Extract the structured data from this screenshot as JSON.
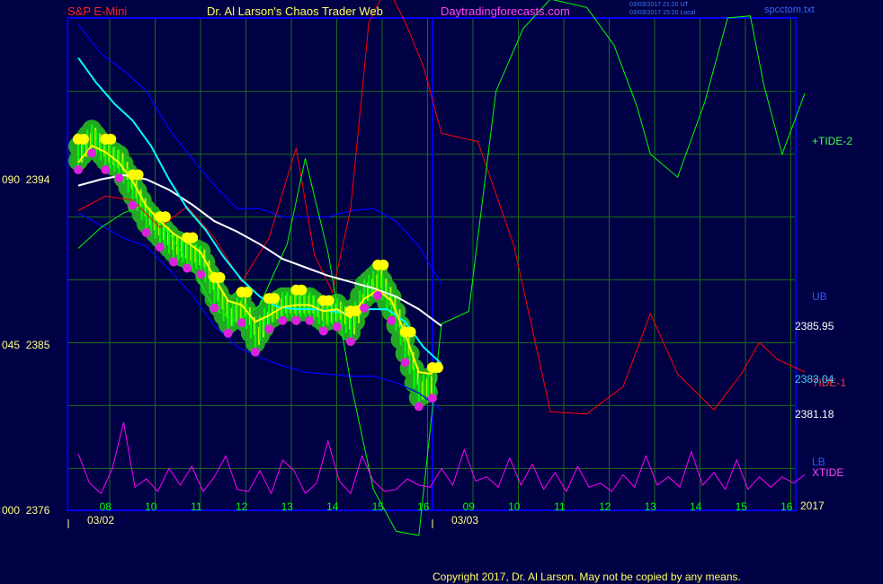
{
  "header": {
    "symbol": "S&P E-Mini",
    "title": "Dr. Al Larson's Chaos Trader Web",
    "website": "Daytradingforecasts.com",
    "stamp_line1": "03/03/2017 21:20 UT",
    "stamp_line2": "03/03/2017 15:20 Local",
    "file_name": "spcctom.txt"
  },
  "footer": {
    "copyright": "Copyright 2017, Dr. Al Larson. May not be copied by any means."
  },
  "colors": {
    "background": "#000044",
    "frame": "#0000ff",
    "grid": "#1c6b1c",
    "price_bar": "#00ff00",
    "ema_fast": "#ffff00",
    "ema_mid": "#00ffff",
    "ema_slow": "#ffffff",
    "band": "#0000ff",
    "tide_1": "#ff0000",
    "tide_2": "#00ff00",
    "xtide": "#ff00ff"
  },
  "chart_data": {
    "type": "line",
    "title": "S&P E-Mini",
    "xlabel": "",
    "ylabel": "",
    "grid": true,
    "x_tick_labels": [
      "08",
      "10",
      "11",
      "12",
      "13",
      "14",
      "15",
      "16",
      "09",
      "10",
      "11",
      "12",
      "13",
      "14",
      "15",
      "16"
    ],
    "date_labels": [
      "03/02",
      "03/03"
    ],
    "y_tick_labels": [
      "090  2394",
      "045  2385",
      "000  2376"
    ],
    "ylim": [
      2376,
      2399.5
    ],
    "right_labels": {
      "tide2": "+TIDE-2",
      "ub": "UB",
      "price_hi": "2385.95",
      "price_mid": "2383.04",
      "tide1": "TIDE-1",
      "price_lo": "2381.18",
      "lb": "LB",
      "xtide": "XTIDE",
      "year": "2017"
    },
    "series": [
      {
        "key": "price",
        "x": [
          0,
          0.3,
          0.6,
          0.9,
          1.2,
          1.5,
          1.8,
          2.1,
          2.4,
          2.7,
          3.0,
          3.3,
          3.6,
          3.9,
          4.2,
          4.5,
          4.8,
          5.1,
          5.4,
          5.7,
          6.0,
          6.3,
          6.6,
          6.9,
          7.2,
          7.5,
          7.8
        ],
        "values": [
          2393.2,
          2394.0,
          2393.2,
          2392.8,
          2391.5,
          2390.2,
          2389.5,
          2388.8,
          2388.5,
          2388.2,
          2386.6,
          2385.4,
          2385.9,
          2384.5,
          2385.6,
          2386.0,
          2386.0,
          2386.0,
          2385.5,
          2385.7,
          2385.0,
          2386.6,
          2387.2,
          2386.0,
          2384.0,
          2381.9,
          2382.3
        ]
      },
      {
        "name": "",
        "key": "ema_fast",
        "x": [
          0,
          0.3,
          0.6,
          0.9,
          1.2,
          1.5,
          1.8,
          2.1,
          2.4,
          2.7,
          3.0,
          3.3,
          3.6,
          3.9,
          4.2,
          4.5,
          4.8,
          5.1,
          5.4,
          5.7,
          6.0,
          6.3,
          6.6,
          6.9,
          7.2,
          7.5,
          7.8
        ],
        "values": [
          2392.6,
          2393.4,
          2393.1,
          2392.6,
          2391.7,
          2390.5,
          2389.8,
          2389.2,
          2388.8,
          2388.3,
          2387.1,
          2386.0,
          2385.8,
          2385.0,
          2385.3,
          2385.7,
          2385.8,
          2385.8,
          2385.5,
          2385.6,
          2385.2,
          2386.1,
          2386.5,
          2386.0,
          2384.4,
          2382.6,
          2382.5
        ]
      },
      {
        "key": "ema_mid",
        "x": [
          0,
          0.4,
          0.8,
          1.2,
          1.6,
          2.0,
          2.4,
          2.8,
          3.2,
          3.6,
          4.0,
          4.4,
          4.8,
          5.2,
          5.6,
          6.0,
          6.4,
          6.8,
          7.2,
          7.6,
          8.0
        ],
        "values": [
          2397.6,
          2396.4,
          2395.4,
          2394.6,
          2393.4,
          2391.8,
          2390.4,
          2389.4,
          2388.1,
          2387.0,
          2386.2,
          2385.7,
          2385.6,
          2385.6,
          2385.5,
          2385.4,
          2385.6,
          2385.6,
          2385.0,
          2383.8,
          2383.0
        ]
      },
      {
        "key": "ema_slow",
        "x": [
          0,
          0.5,
          1.0,
          1.5,
          2.0,
          2.5,
          3.0,
          3.5,
          4.0,
          4.5,
          5.0,
          5.5,
          6.0,
          6.5,
          7.0,
          7.5,
          8.0
        ],
        "values": [
          2391.5,
          2391.8,
          2392.0,
          2391.8,
          2391.3,
          2390.6,
          2389.8,
          2389.3,
          2388.7,
          2388.0,
          2387.6,
          2387.2,
          2386.9,
          2386.6,
          2386.2,
          2385.6,
          2384.8
        ]
      },
      {
        "key": "upper_band",
        "x": [
          0,
          0.5,
          1.0,
          1.5,
          2.0,
          2.5,
          3.0,
          3.5,
          4.0,
          4.5,
          5.0,
          5.5,
          6.0,
          6.5,
          7.0,
          7.5,
          8.0
        ],
        "values": [
          2399.2,
          2397.8,
          2397.0,
          2396.0,
          2394.2,
          2392.8,
          2391.5,
          2390.4,
          2390.4,
          2390.0,
          2390.0,
          2390.0,
          2390.3,
          2390.4,
          2389.8,
          2388.6,
          2386.8
        ]
      },
      {
        "key": "lower_band",
        "x": [
          0,
          0.5,
          1.0,
          1.5,
          2.0,
          2.5,
          3.0,
          3.5,
          4.0,
          4.5,
          5.0,
          5.5,
          6.0,
          6.5,
          7.0,
          7.5,
          8.0
        ],
        "values": [
          2390.2,
          2389.6,
          2389.0,
          2388.6,
          2387.5,
          2386.3,
          2384.8,
          2383.8,
          2383.3,
          2382.9,
          2382.6,
          2382.5,
          2382.4,
          2382.4,
          2382.1,
          2381.6,
          2380.8
        ]
      },
      {
        "name": "TIDE-1",
        "key": "tide1",
        "x": [
          0,
          0.6,
          1.2,
          1.8,
          2.4,
          3.0,
          3.6,
          4.2,
          4.8,
          5.2,
          5.6,
          6.0,
          6.4,
          6.8,
          7.2,
          7.6,
          8.0,
          8.8,
          9.6,
          10.4,
          11.2,
          12.0,
          12.6,
          13.2,
          14.0,
          14.6,
          15.0,
          15.4,
          16.0
        ],
        "values": [
          2390.3,
          2391.0,
          2390.8,
          2389.5,
          2390.5,
          2389.0,
          2386.9,
          2389.0,
          2393.3,
          2388.2,
          2386.4,
          2390.4,
          2399.3,
          2401.0,
          2399.3,
          2397.2,
          2394.0,
          2393.6,
          2388.6,
          2380.7,
          2380.6,
          2381.9,
          2385.4,
          2382.5,
          2380.8,
          2382.5,
          2384.0,
          2383.2,
          2382.6
        ]
      },
      {
        "name": "+TIDE-2",
        "key": "tide2",
        "x": [
          0,
          0.5,
          1.0,
          1.5,
          2.0,
          2.5,
          3.0,
          3.5,
          4.0,
          4.6,
          5.0,
          5.5,
          6.0,
          6.5,
          7.0,
          7.5,
          8.0,
          8.6,
          9.2,
          9.8,
          10.4,
          11.2,
          11.8,
          12.3,
          12.6,
          13.2,
          13.8,
          14.3,
          14.8,
          15.1,
          15.5,
          16.0
        ],
        "values": [
          2388.5,
          2389.5,
          2390.2,
          2390.6,
          2389.2,
          2387.6,
          2385.6,
          2385.0,
          2385.8,
          2388.7,
          2392.8,
          2388.3,
          2382.1,
          2377.0,
          2375.0,
          2374.8,
          2384.9,
          2385.5,
          2396.0,
          2399.0,
          2400.4,
          2400.0,
          2398.2,
          2395.3,
          2393.0,
          2391.9,
          2395.5,
          2399.5,
          2399.6,
          2396.3,
          2393.0,
          2395.9
        ]
      },
      {
        "name": "XTIDE",
        "key": "xtide",
        "x": [
          0,
          0.25,
          0.5,
          0.75,
          1.0,
          1.25,
          1.5,
          1.75,
          2.0,
          2.25,
          2.5,
          2.75,
          3.0,
          3.25,
          3.5,
          3.75,
          4.0,
          4.25,
          4.5,
          4.75,
          5.0,
          5.25,
          5.5,
          5.75,
          6.0,
          6.25,
          6.5,
          6.75,
          7.0,
          7.25,
          7.5,
          7.75,
          8.0,
          8.25,
          8.5,
          8.75,
          9.0,
          9.25,
          9.5,
          9.75,
          10.0,
          10.25,
          10.5,
          10.75,
          11.0,
          11.25,
          11.5,
          11.75,
          12.0,
          12.25,
          12.5,
          12.75,
          13.0,
          13.25,
          13.5,
          13.75,
          14.0,
          14.25,
          14.5,
          14.75,
          15.0,
          15.25,
          15.5,
          15.75,
          16.0
        ],
        "values": [
          2378.7,
          2377.3,
          2376.8,
          2378.0,
          2380.2,
          2377.1,
          2377.5,
          2376.9,
          2378.0,
          2377.2,
          2378.1,
          2376.9,
          2377.6,
          2378.6,
          2377.0,
          2376.9,
          2377.9,
          2376.8,
          2378.4,
          2377.9,
          2376.8,
          2377.3,
          2379.3,
          2377.4,
          2376.8,
          2378.6,
          2377.4,
          2376.9,
          2377.0,
          2377.5,
          2377.2,
          2377.1,
          2378.0,
          2377.2,
          2378.9,
          2377.4,
          2377.6,
          2377.1,
          2378.5,
          2377.2,
          2378.2,
          2377.0,
          2377.8,
          2376.9,
          2378.1,
          2377.1,
          2377.3,
          2376.9,
          2377.7,
          2377.1,
          2378.6,
          2377.2,
          2377.6,
          2377.1,
          2378.8,
          2377.2,
          2377.8,
          2377.0,
          2378.4,
          2377.0,
          2377.6,
          2377.1,
          2377.6,
          2377.3,
          2377.7
        ]
      }
    ]
  }
}
